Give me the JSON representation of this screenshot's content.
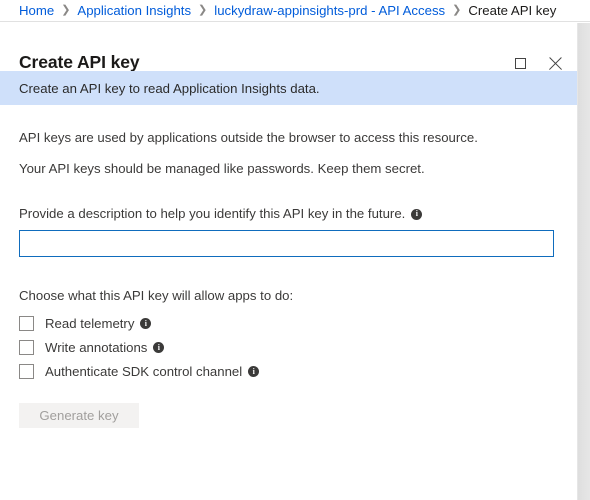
{
  "breadcrumb": {
    "separator": "❯",
    "items": [
      {
        "label": "Home",
        "current": false
      },
      {
        "label": "Application Insights",
        "current": false
      },
      {
        "label": "luckydraw-appinsights-prd - API Access",
        "current": false
      },
      {
        "label": "Create API key",
        "current": true
      }
    ]
  },
  "blade": {
    "title": "Create API key",
    "window_controls": {
      "maximize": "maximize-icon",
      "close": "close-icon"
    },
    "banner": {
      "text": "Create an API key to read Application Insights data.",
      "background": "#cfe0fa"
    },
    "paragraphs": [
      "API keys are used by applications outside the browser to access this resource.",
      "Your API keys should be managed like passwords. Keep them secret."
    ],
    "description_field": {
      "label": "Provide a description to help you identify this API key in the future.",
      "info_icon": "info-icon",
      "value": "",
      "placeholder": "",
      "focus_border_color": "#0f6cbd"
    },
    "permissions": {
      "label": "Choose what this API key will allow apps to do:",
      "options": [
        {
          "label": "Read telemetry",
          "checked": false,
          "info_icon": "info-icon"
        },
        {
          "label": "Write annotations",
          "checked": false,
          "info_icon": "info-icon"
        },
        {
          "label": "Authenticate SDK control channel",
          "checked": false,
          "info_icon": "info-icon"
        }
      ]
    },
    "generate_button": {
      "label": "Generate key",
      "disabled": true
    }
  },
  "colors": {
    "link": "#015cda",
    "text": "#3b3a39",
    "banner_bg": "#cfe0fa",
    "accent": "#0f6cbd",
    "disabled_bg": "#f3f2f1",
    "disabled_text": "#a19f9d"
  }
}
